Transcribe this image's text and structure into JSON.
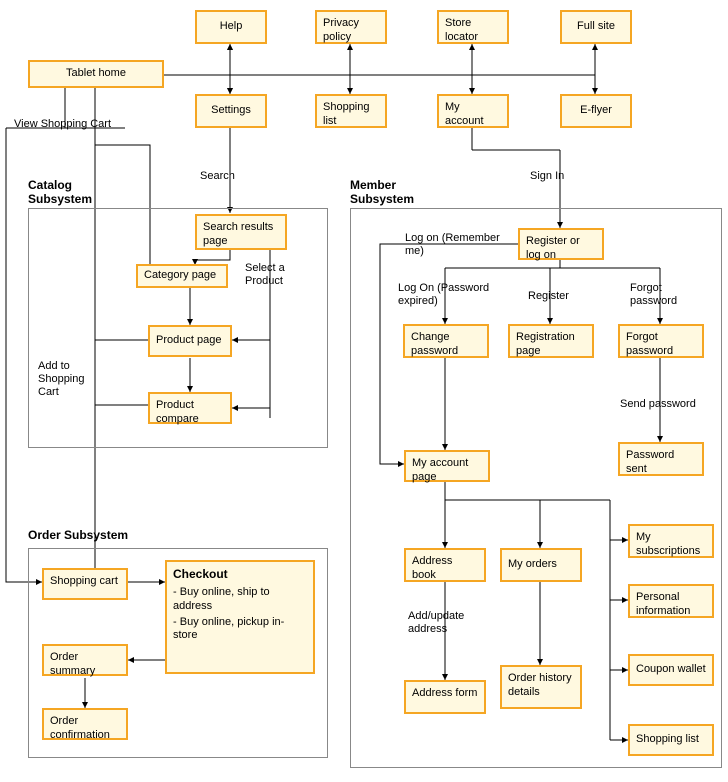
{
  "topnav": {
    "help": "Help",
    "privacy": "Privacy policy",
    "store_locator": "Store locator",
    "full_site": "Full site",
    "settings": "Settings",
    "shopping_list": "Shopping list",
    "my_account": "My account",
    "eflyer": "E-flyer"
  },
  "tablet_home": "Tablet home",
  "links": {
    "view_cart": "View Shopping Cart",
    "search": "Search",
    "sign_in": "Sign In"
  },
  "catalog": {
    "title": "Catalog Subsystem",
    "search_results": "Search results page",
    "category_page": "Category page",
    "product_page": "Product page",
    "product_compare": "Product compare",
    "select_product": "Select a Product",
    "add_to_cart": "Add to Shopping Cart"
  },
  "order": {
    "title": "Order Subsystem",
    "shopping_cart": "Shopping cart",
    "checkout_title": "Checkout",
    "checkout_b1": "Buy online, ship to address",
    "checkout_b2": "Buy online, pickup in-store",
    "order_summary": "Order summary",
    "order_confirm": "Order confirmation"
  },
  "member": {
    "title": "Member Subsystem",
    "register_logon": "Register or log on",
    "log_on_remember": "Log on (Remember me)",
    "log_on_expired": "Log On (Password expired)",
    "register": "Register",
    "forgot_pw_label": "Forgot password",
    "change_pw": "Change password",
    "registration_page": "Registration page",
    "forgot_pw_box": "Forgot password",
    "send_password": "Send password",
    "password_sent": "Password sent",
    "my_account_page": "My account page",
    "address_book": "Address book",
    "my_orders": "My orders",
    "add_update_addr": "Add/update address",
    "address_form": "Address form",
    "order_history": "Order history details",
    "my_subs": "My subscriptions",
    "personal_info": "Personal information",
    "coupon_wallet": "Coupon wallet",
    "shopping_list": "Shopping list"
  }
}
